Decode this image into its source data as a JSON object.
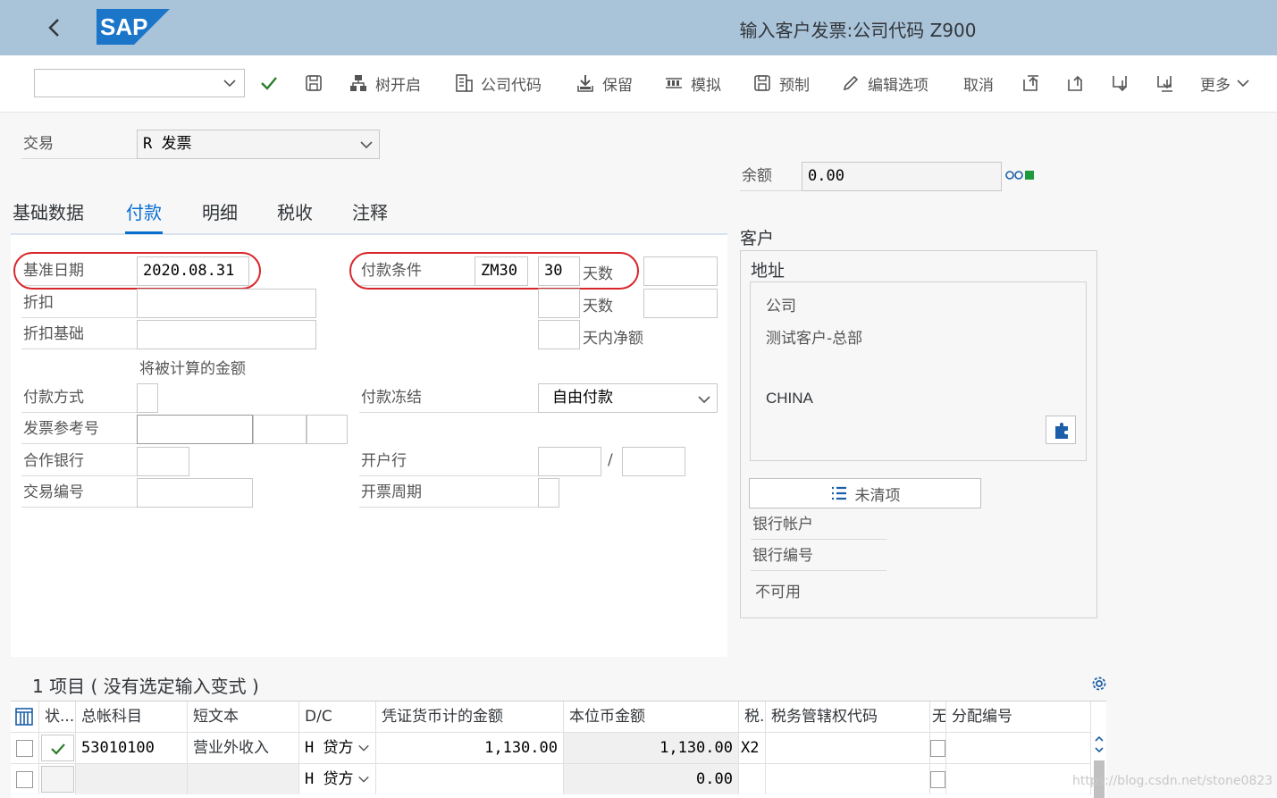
{
  "header": {
    "title": "输入客户发票:公司代码 Z900",
    "logo_text": "SAP"
  },
  "toolbar": {
    "combo_value": "",
    "tree_label": "树开启",
    "company_code_label": "公司代码",
    "park_label": "保留",
    "simulate_label": "模拟",
    "preview_label": "预制",
    "edit_options_label": "编辑选项",
    "cancel_label": "取消",
    "more_label": "更多"
  },
  "transaction": {
    "label": "交易",
    "value": "R  发票"
  },
  "balance": {
    "label": "余额",
    "value": "0.00"
  },
  "tabs": [
    "基础数据",
    "付款",
    "明细",
    "税收",
    "注释"
  ],
  "payment": {
    "baseline_date_label": "基准日期",
    "baseline_date_value": "2020.08.31",
    "discount_label": "折扣",
    "discount_base_label": "折扣基础",
    "amount_calc_note": "将被计算的金额",
    "payment_method_label": "付款方式",
    "invoice_ref_label": "发票参考号",
    "partner_bank_label": "合作银行",
    "transaction_no_label": "交易编号",
    "terms_label": "付款条件",
    "terms_value": "ZM30",
    "days_value": "30",
    "days_label": "天数",
    "days_label2": "天数",
    "net_label": "天内净额",
    "block_label": "付款冻结",
    "block_value": "自由付款",
    "house_bank_label": "开户行",
    "slash": "/",
    "invoicing_period_label": "开票周期"
  },
  "customer": {
    "section_label": "客户",
    "address_label": "地址",
    "line1": "公司",
    "line2": "测试客户-总部",
    "country": "CHINA",
    "open_items_label": "未清项",
    "bank_account_label": "银行帐户",
    "bank_number_label": "银行编号",
    "not_available": "不可用"
  },
  "items": {
    "title": "1 项目 ( 没有选定输入变式 )",
    "columns": [
      "状...",
      "总帐科目",
      "短文本",
      "D/C",
      "凭证货币计的金额",
      "本位币金额",
      "税.",
      "税务管辖权代码",
      "无",
      "分配编号"
    ],
    "rows": [
      {
        "gl": "53010100",
        "text": "营业外收入",
        "dc": "H  贷方",
        "amount": "1,130.00",
        "local": "1,130.00",
        "tax": "X2"
      },
      {
        "gl": "",
        "text": "",
        "dc": "H  贷方",
        "amount": "",
        "local": "0.00",
        "tax": ""
      }
    ]
  },
  "watermark": "https://blog.csdn.net/stone0823"
}
